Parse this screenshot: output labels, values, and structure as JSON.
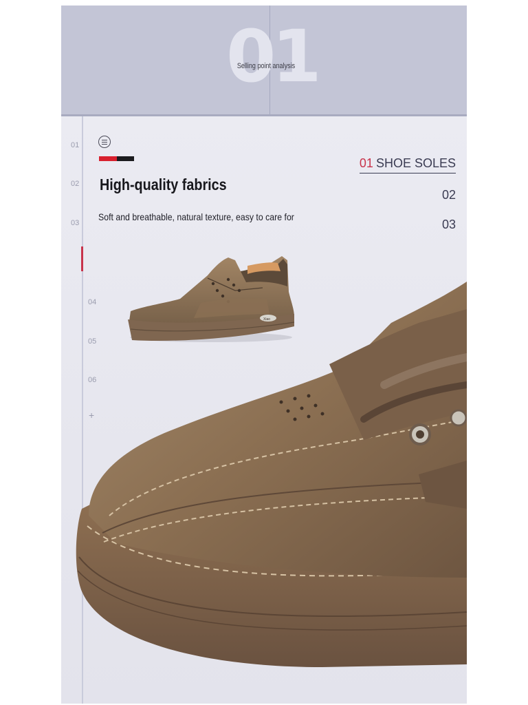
{
  "header": {
    "number": "01",
    "subtitle": "Selling point analysis"
  },
  "sidebar": {
    "items": [
      "01",
      "02",
      "03",
      "04",
      "05",
      "06"
    ],
    "plus": "+"
  },
  "feature": {
    "title": "High-quality fabrics",
    "description": "Soft and breathable, natural texture, easy to care for"
  },
  "nav": {
    "active_number": "01",
    "active_label": "SHOE SOLES",
    "items": [
      "02",
      "03"
    ]
  },
  "product": {
    "badge_text": "Xiao"
  },
  "colors": {
    "accent_red": "#d8202e",
    "header_band": "#c3c5d6",
    "leather": "#8f7254"
  }
}
